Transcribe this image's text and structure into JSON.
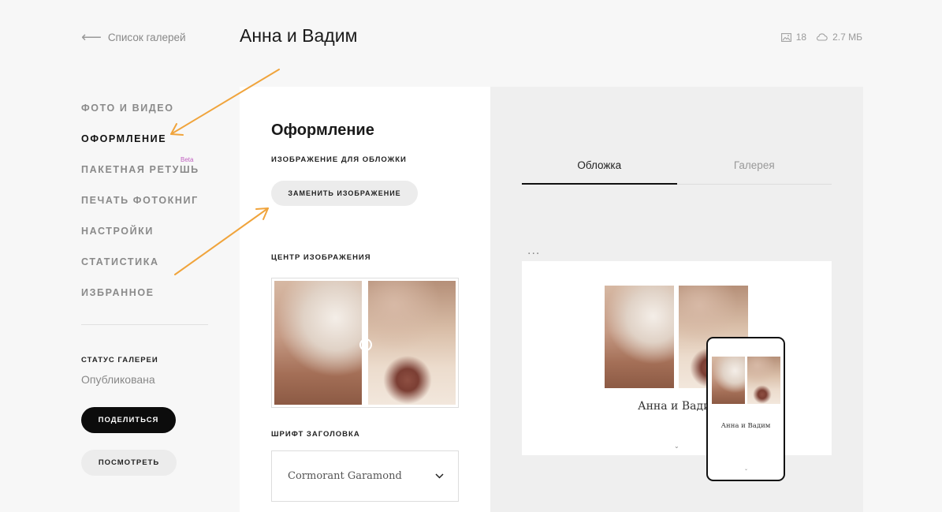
{
  "header": {
    "back_label": "Список галерей",
    "title": "Анна и Вадим",
    "photo_count": "18",
    "storage": "2.7 МБ"
  },
  "sidebar": {
    "items": [
      {
        "label": "ФОТО И ВИДЕО"
      },
      {
        "label": "ОФОРМЛЕНИЕ",
        "active": true
      },
      {
        "label": "ПАКЕТНАЯ РЕТУШЬ",
        "badge": "Beta"
      },
      {
        "label": "ПЕЧАТЬ ФОТОКНИГ"
      },
      {
        "label": "НАСТРОЙКИ"
      },
      {
        "label": "СТАТИСТИКА"
      },
      {
        "label": "ИЗБРАННОЕ"
      }
    ],
    "status_label": "СТАТУС ГАЛЕРЕИ",
    "status_value": "Опубликована",
    "share_label": "ПОДЕЛИТЬСЯ",
    "view_label": "ПОСМОТРЕТЬ"
  },
  "panel": {
    "title": "Оформление",
    "cover_label": "ИЗОБРАЖЕНИЕ ДЛЯ ОБЛОЖКИ",
    "replace_label": "ЗАМЕНИТЬ ИЗОБРАЖЕНИЕ",
    "center_label": "ЦЕНТР ИЗОБРАЖЕНИЯ",
    "font_label": "ШРИФТ ЗАГОЛОВКА",
    "font_value": "Cormorant Garamond"
  },
  "preview": {
    "tabs": [
      {
        "label": "Обложка",
        "active": true
      },
      {
        "label": "Галерея"
      }
    ],
    "more_label": "...",
    "cover_title_desktop": "Анна и Вадим",
    "cover_title_mobile": "Анна и Вадим"
  },
  "colors": {
    "accent_arrow": "#f0a43c",
    "active_text": "#111111",
    "muted_text": "#8a8a8a",
    "share_button": "#0c0c0c",
    "beta_badge": "#c060c0"
  }
}
